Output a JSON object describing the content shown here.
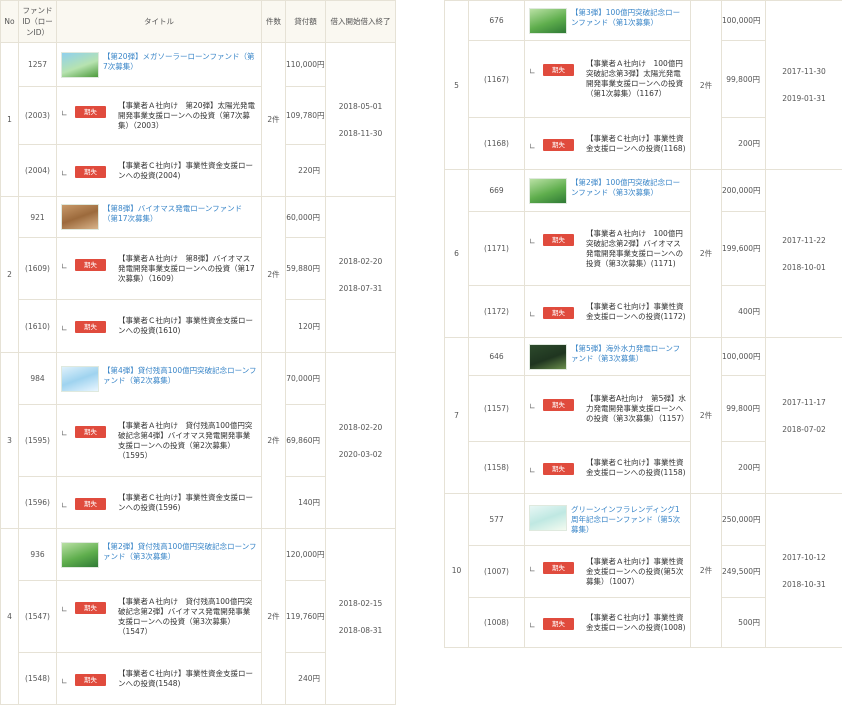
{
  "header": {
    "no": "No",
    "fund_id": "ファンドID（ローンID）",
    "title": "タイトル",
    "count": "件数",
    "amount": "貸付額",
    "dates": "借入開始借入終了"
  },
  "badge_label": "期失",
  "left_groups": [
    {
      "no": "1",
      "count": "2件",
      "start": "2018-05-01",
      "end": "2018-11-30",
      "fund": {
        "id": "1257",
        "title": "【第20弾】メガソーラーローンファンド（第7次募集）",
        "amount": "110,000円"
      },
      "subs": [
        {
          "id": "(2003)",
          "text": "【事業者Ａ社向け　第20弾】太陽光発電開発事業支援ローンへの投資（第7次募集）（2003）",
          "amount": "109,780円"
        },
        {
          "id": "(2004)",
          "text": "【事業者Ｃ社向け】事業性資金支援ローンへの投資(2004)",
          "amount": "220円"
        }
      ]
    },
    {
      "no": "2",
      "count": "2件",
      "start": "2018-02-20",
      "end": "2018-07-31",
      "fund": {
        "id": "921",
        "title": "【第8弾】バイオマス発電ローンファンド（第17次募集）",
        "amount": "60,000円"
      },
      "subs": [
        {
          "id": "(1609)",
          "text": "【事業者Ａ社向け　第8弾】バイオマス発電開発事業支援ローンへの投資（第17次募集）（1609）",
          "amount": "59,880円"
        },
        {
          "id": "(1610)",
          "text": "【事業者Ｃ社向け】事業性資金支援ローンへの投資(1610)",
          "amount": "120円"
        }
      ]
    },
    {
      "no": "3",
      "count": "2件",
      "start": "2018-02-20",
      "end": "2020-03-02",
      "fund": {
        "id": "984",
        "title": "【第4弾】貸付残高100億円突破記念ローンファンド（第2次募集）",
        "amount": "70,000円"
      },
      "subs": [
        {
          "id": "(1595)",
          "text": "【事業者Ａ社向け　貸付残高100億円突破記念第4弾】バイオマス発電開発事業支援ローンへの投資（第2次募集）（1595）",
          "amount": "69,860円"
        },
        {
          "id": "(1596)",
          "text": "【事業者Ｃ社向け】事業性資金支援ローンへの投資(1596)",
          "amount": "140円"
        }
      ]
    },
    {
      "no": "4",
      "count": "2件",
      "start": "2018-02-15",
      "end": "2018-08-31",
      "fund": {
        "id": "936",
        "title": "【第2弾】貸付残高100億円突破記念ローンファンド（第3次募集）",
        "amount": "120,000円"
      },
      "subs": [
        {
          "id": "(1547)",
          "text": "【事業者Ａ社向け　貸付残高100億円突破記念第2弾】バイオマス発電開発事業支援ローンへの投資（第3次募集）（1547）",
          "amount": "119,760円"
        },
        {
          "id": "(1548)",
          "text": "【事業者Ｃ社向け】事業性資金支援ローンへの投資(1548)",
          "amount": "240円"
        }
      ]
    }
  ],
  "right_groups": [
    {
      "no": "5",
      "count": "2件",
      "start": "2017-11-30",
      "end": "2019-01-31",
      "fund": {
        "id": "676",
        "title": "【第3弾】100億円突破記念ローンファンド（第1次募集）",
        "amount": "100,000円"
      },
      "subs": [
        {
          "id": "(1167)",
          "text": "【事業者Ａ社向け　100億円突破記念第3弾】太陽光発電開発事業支援ローンへの投資（第1次募集）（1167）",
          "amount": "99,800円"
        },
        {
          "id": "(1168)",
          "text": "【事業者Ｃ社向け】事業性資金支援ローンへの投資(1168)",
          "amount": "200円"
        }
      ]
    },
    {
      "no": "6",
      "count": "2件",
      "start": "2017-11-22",
      "end": "2018-10-01",
      "fund": {
        "id": "669",
        "title": "【第2弾】100億円突破記念ローンファンド（第3次募集）",
        "amount": "200,000円"
      },
      "subs": [
        {
          "id": "(1171)",
          "text": "【事業者Ａ社向け　100億円突破記念第2弾】バイオマス発電開発事業支援ローンへの投資（第3次募集）(1171)",
          "amount": "199,600円"
        },
        {
          "id": "(1172)",
          "text": "【事業者Ｃ社向け】事業性資金支援ローンへの投資(1172)",
          "amount": "400円"
        }
      ]
    },
    {
      "no": "7",
      "count": "2件",
      "start": "2017-11-17",
      "end": "2018-07-02",
      "fund": {
        "id": "646",
        "title": "【第5弾】海外水力発電ローンファンド（第3次募集）",
        "amount": "100,000円"
      },
      "subs": [
        {
          "id": "(1157)",
          "text": "【事業者A社向け　第5弾】水力発電開発事業支援ローンへの投資（第3次募集）（1157）",
          "amount": "99,800円"
        },
        {
          "id": "(1158)",
          "text": "【事業者Ｃ社向け】事業性資金支援ローンへの投資(1158)",
          "amount": "200円"
        }
      ]
    },
    {
      "no": "10",
      "count": "2件",
      "start": "2017-10-12",
      "end": "2018-10-31",
      "fund": {
        "id": "577",
        "title": "グリーンインフラレンディング1周年記念ローンファンド（第5次募集）",
        "amount": "250,000円"
      },
      "subs": [
        {
          "id": "(1007)",
          "text": "【事業者Ａ社向け】事業性資金支援ローンへの投資(第5次募集）（1007）",
          "amount": "249,500円"
        },
        {
          "id": "(1008)",
          "text": "【事業者Ｃ社向け】事業性資金支援ローンへの投資(1008)",
          "amount": "500円"
        }
      ]
    }
  ],
  "thumbs": {
    "left": [
      "sky-solar",
      "wood-biomass",
      "blue-banner",
      "forest-green"
    ],
    "right": [
      "forest-green",
      "forest-green",
      "night-waterfall",
      "logo-banner"
    ]
  }
}
